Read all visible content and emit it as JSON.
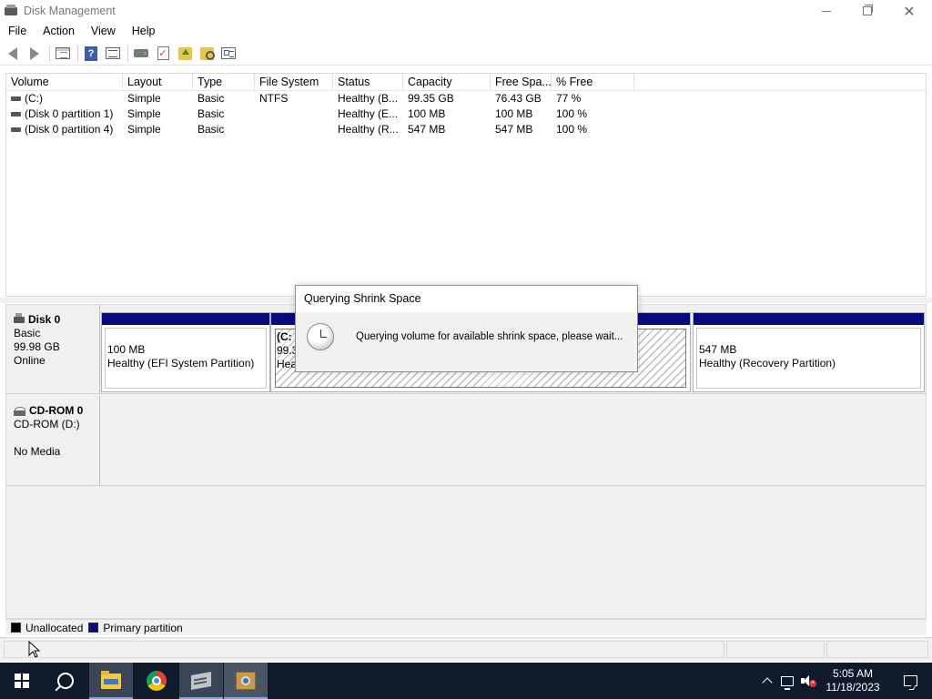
{
  "window": {
    "title": "Disk Management"
  },
  "menu": {
    "items": [
      "File",
      "Action",
      "View",
      "Help"
    ]
  },
  "toolbar": {
    "icons": [
      "back-icon",
      "forward-icon",
      "console-tree-icon",
      "help-icon",
      "show-hide-icon",
      "rescan-disks-icon",
      "check-icon",
      "folder-up-icon",
      "folder-search-icon",
      "properties-icon"
    ]
  },
  "volume_list": {
    "columns": [
      "Volume",
      "Layout",
      "Type",
      "File System",
      "Status",
      "Capacity",
      "Free Spa...",
      "% Free"
    ],
    "rows": [
      {
        "volume": "(C:)",
        "layout": "Simple",
        "type": "Basic",
        "fs": "NTFS",
        "status": "Healthy (B...",
        "capacity": "99.35 GB",
        "free": "76.43 GB",
        "pct": "77 %"
      },
      {
        "volume": "(Disk 0 partition 1)",
        "layout": "Simple",
        "type": "Basic",
        "fs": "",
        "status": "Healthy (E...",
        "capacity": "100 MB",
        "free": "100 MB",
        "pct": "100 %"
      },
      {
        "volume": "(Disk 0 partition 4)",
        "layout": "Simple",
        "type": "Basic",
        "fs": "",
        "status": "Healthy (R...",
        "capacity": "547 MB",
        "free": "547 MB",
        "pct": "100 %"
      }
    ]
  },
  "disks": {
    "disk0": {
      "name": "Disk 0",
      "type": "Basic",
      "size": "99.98 GB",
      "state": "Online",
      "partitions": {
        "efi": {
          "size": "100 MB",
          "status": "Healthy (EFI System Partition)"
        },
        "c": {
          "label": "(C:",
          "size": "99.3",
          "status": "Hea"
        },
        "recovery": {
          "size": "547 MB",
          "status": "Healthy (Recovery Partition)"
        }
      }
    },
    "cdrom0": {
      "name": "CD-ROM 0",
      "drive": "CD-ROM (D:)",
      "media": "No Media"
    }
  },
  "legend": {
    "unallocated": "Unallocated",
    "primary": "Primary partition",
    "colors": {
      "unallocated": "#000000",
      "primary": "#0a0a80"
    }
  },
  "dialog": {
    "title": "Querying Shrink Space",
    "message": "Querying volume for available shrink space, please wait..."
  },
  "taskbar": {
    "apps": [
      "start-icon",
      "search-icon",
      "file-explorer-icon",
      "chrome-icon",
      "server-manager-icon",
      "disk-management-icon"
    ],
    "time": "5:05 AM",
    "date": "11/18/2023"
  }
}
